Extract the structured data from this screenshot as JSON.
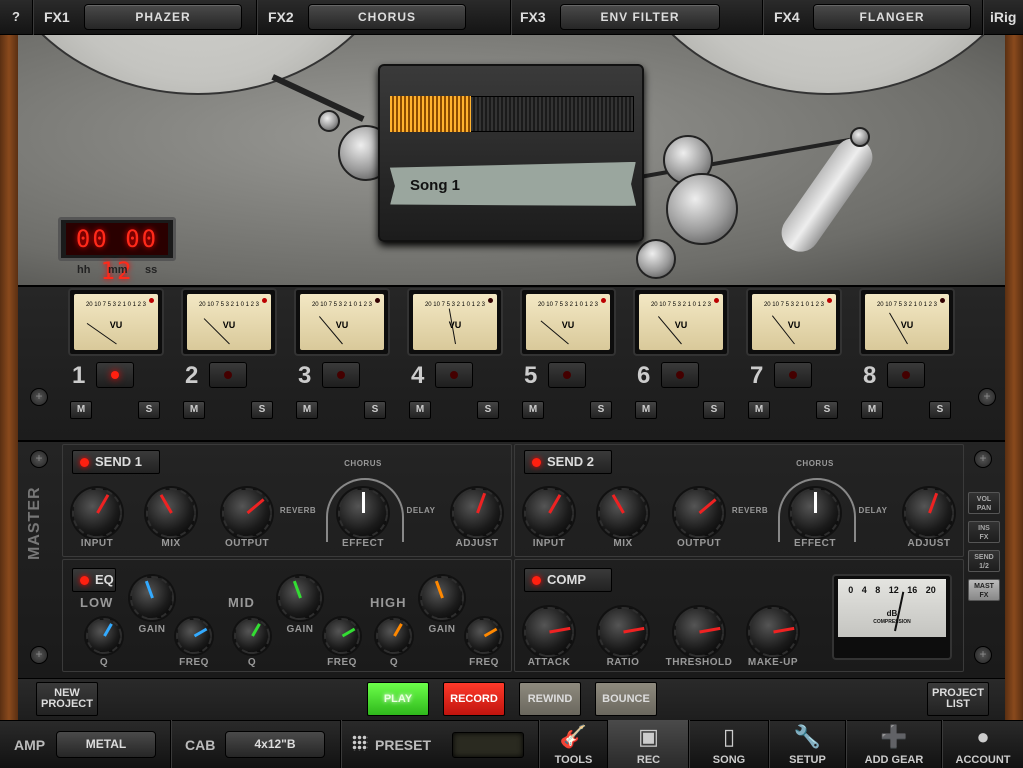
{
  "top_bar": {
    "help_label": "?",
    "fx_slots": [
      {
        "label": "FX1",
        "value": "PHAZER"
      },
      {
        "label": "FX2",
        "value": "CHORUS"
      },
      {
        "label": "FX3",
        "value": "ENV FILTER"
      },
      {
        "label": "FX4",
        "value": "FLANGER"
      }
    ],
    "brand": "iRig"
  },
  "tape_deck": {
    "counter": "00 00 12",
    "time_labels": [
      "hh",
      "mm",
      "ss"
    ],
    "song_name": "Song 1",
    "progress": 0.33
  },
  "mixer": {
    "vu_label": "VU",
    "vu_scale": "20 10 7 5 3 2 1 0 1 2 3",
    "mute_label": "M",
    "solo_label": "S",
    "channels": [
      {
        "number": "1",
        "armed": true,
        "level": -55,
        "peak": true
      },
      {
        "number": "2",
        "armed": false,
        "level": -45,
        "peak": true
      },
      {
        "number": "3",
        "armed": false,
        "level": -40,
        "peak": false
      },
      {
        "number": "4",
        "armed": false,
        "level": -10,
        "peak": false
      },
      {
        "number": "5",
        "armed": false,
        "level": -50,
        "peak": true
      },
      {
        "number": "6",
        "armed": false,
        "level": -40,
        "peak": true
      },
      {
        "number": "7",
        "armed": false,
        "level": -38,
        "peak": true
      },
      {
        "number": "8",
        "armed": false,
        "level": -30,
        "peak": false
      }
    ]
  },
  "master": {
    "label": "MASTER",
    "send1": {
      "title": "SEND 1",
      "knobs": [
        "INPUT",
        "MIX",
        "OUTPUT"
      ],
      "effect": {
        "label": "EFFECT",
        "left": "REVERB",
        "top": "CHORUS",
        "right": "DELAY",
        "ticks": [
          "3",
          "2",
          "1",
          "1",
          "2",
          "3",
          "2",
          "2",
          "3",
          "3"
        ]
      },
      "adjust": "ADJUST"
    },
    "send2": {
      "title": "SEND 2",
      "knobs": [
        "INPUT",
        "MIX",
        "OUTPUT"
      ],
      "effect": {
        "label": "EFFECT",
        "left": "REVERB",
        "top": "CHORUS",
        "right": "DELAY",
        "ticks": [
          "3",
          "2",
          "1",
          "1",
          "2",
          "3",
          "2",
          "2",
          "3",
          "3"
        ]
      },
      "adjust": "ADJUST"
    },
    "eq": {
      "title": "EQ",
      "bands": [
        {
          "name": "LOW",
          "gain": "GAIN",
          "q": "Q",
          "freq": "FREQ"
        },
        {
          "name": "MID",
          "gain": "GAIN",
          "q": "Q",
          "freq": "FREQ"
        },
        {
          "name": "HIGH",
          "gain": "GAIN",
          "q": "Q",
          "freq": "FREQ"
        }
      ]
    },
    "comp": {
      "title": "COMP",
      "knobs": [
        "ATTACK",
        "RATIO",
        "THRESHOLD",
        "MAKE-UP"
      ],
      "meter": {
        "unit": "dB",
        "label": "COMPRESSION",
        "scale": [
          "0",
          "4",
          "8",
          "12",
          "16",
          "20"
        ]
      }
    },
    "side_buttons": [
      {
        "line1": "VOL",
        "line2": "PAN",
        "active": false
      },
      {
        "line1": "INS",
        "line2": "FX",
        "active": false
      },
      {
        "line1": "SEND",
        "line2": "1/2",
        "active": false
      },
      {
        "line1": "MAST",
        "line2": "FX",
        "active": true
      }
    ]
  },
  "transport": {
    "new_project": "NEW PROJECT",
    "play": "PLAY",
    "record": "RECORD",
    "rewind": "REWIND",
    "bounce": "BOUNCE",
    "project_list": "PROJECT LIST"
  },
  "bottom_bar": {
    "amp_label": "AMP",
    "amp_value": "METAL",
    "cab_label": "CAB",
    "cab_value": "4x12\"B",
    "preset_label": "PRESET",
    "nav": [
      {
        "label": "TOOLS",
        "icon": "guitar-icon",
        "active": false
      },
      {
        "label": "REC",
        "icon": "tape-recorder-icon",
        "active": true
      },
      {
        "label": "SONG",
        "icon": "ipod-icon",
        "active": false
      },
      {
        "label": "SETUP",
        "icon": "wrench-icon",
        "active": false
      },
      {
        "label": "ADD GEAR",
        "icon": "device-add-icon",
        "active": false
      },
      {
        "label": "ACCOUNT",
        "icon": "user-icon",
        "active": false
      }
    ]
  },
  "colors": {
    "led_red": "#ff2010",
    "counter_red": "#ff2a1a",
    "progress_orange": "#ffb22e",
    "play_green": "#3fd22a",
    "record_red": "#e0201a",
    "wood": "#8a4a1d"
  }
}
